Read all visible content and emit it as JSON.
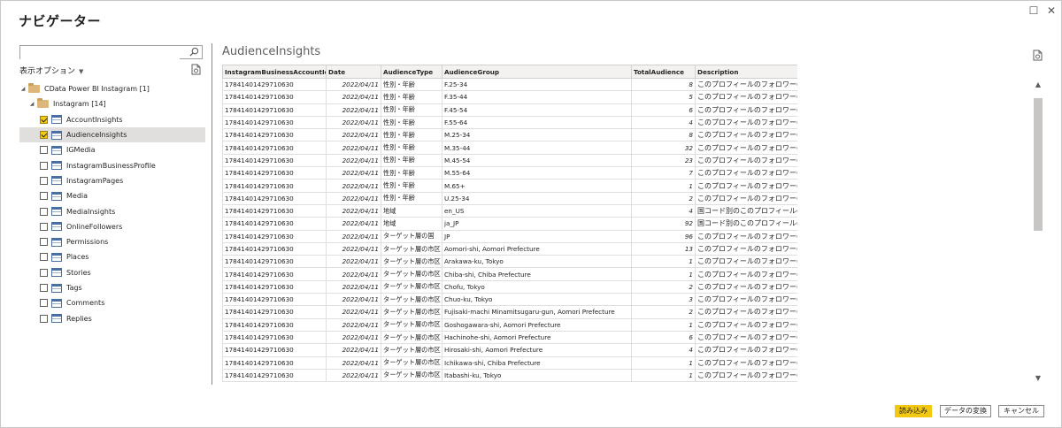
{
  "window": {
    "title": "ナビゲーター",
    "restore_glyph": "☐",
    "close_glyph": "✕"
  },
  "left": {
    "search": {
      "value": "",
      "placeholder": ""
    },
    "display_options": "表示オプション",
    "tree": {
      "root": {
        "label": "CData Power BI Instagram [1]"
      },
      "folder": {
        "label": "Instagram [14]"
      },
      "items": [
        {
          "label": "AccountInsights",
          "checked": true,
          "selected": false
        },
        {
          "label": "AudienceInsights",
          "checked": true,
          "selected": true
        },
        {
          "label": "IGMedia",
          "checked": false,
          "selected": false
        },
        {
          "label": "InstagramBusinessProfile",
          "checked": false,
          "selected": false
        },
        {
          "label": "InstagramPages",
          "checked": false,
          "selected": false
        },
        {
          "label": "Media",
          "checked": false,
          "selected": false
        },
        {
          "label": "MediaInsights",
          "checked": false,
          "selected": false
        },
        {
          "label": "OnlineFollowers",
          "checked": false,
          "selected": false
        },
        {
          "label": "Permissions",
          "checked": false,
          "selected": false
        },
        {
          "label": "Places",
          "checked": false,
          "selected": false
        },
        {
          "label": "Stories",
          "checked": false,
          "selected": false
        },
        {
          "label": "Tags",
          "checked": false,
          "selected": false
        },
        {
          "label": "Comments",
          "checked": false,
          "selected": false
        },
        {
          "label": "Replies",
          "checked": false,
          "selected": false
        }
      ]
    }
  },
  "preview": {
    "title": "AudienceInsights",
    "columns": [
      "InstagramBusinessAccountId",
      "Date",
      "AudienceType",
      "AudienceGroup",
      "TotalAudience",
      "Description"
    ],
    "rows": [
      [
        "17841401429710630",
        "2022/04/11",
        "性別・年齢",
        "F.25-34",
        "8",
        "このプロフィールのフォロワーの"
      ],
      [
        "17841401429710630",
        "2022/04/11",
        "性別・年齢",
        "F.35-44",
        "5",
        "このプロフィールのフォロワーの"
      ],
      [
        "17841401429710630",
        "2022/04/11",
        "性別・年齢",
        "F.45-54",
        "6",
        "このプロフィールのフォロワーの"
      ],
      [
        "17841401429710630",
        "2022/04/11",
        "性別・年齢",
        "F.55-64",
        "4",
        "このプロフィールのフォロワーの"
      ],
      [
        "17841401429710630",
        "2022/04/11",
        "性別・年齢",
        "M.25-34",
        "8",
        "このプロフィールのフォロワーの"
      ],
      [
        "17841401429710630",
        "2022/04/11",
        "性別・年齢",
        "M.35-44",
        "32",
        "このプロフィールのフォロワーの"
      ],
      [
        "17841401429710630",
        "2022/04/11",
        "性別・年齢",
        "M.45-54",
        "23",
        "このプロフィールのフォロワーの"
      ],
      [
        "17841401429710630",
        "2022/04/11",
        "性別・年齢",
        "M.55-64",
        "7",
        "このプロフィールのフォロワーの"
      ],
      [
        "17841401429710630",
        "2022/04/11",
        "性別・年齢",
        "M.65+",
        "1",
        "このプロフィールのフォロワーの"
      ],
      [
        "17841401429710630",
        "2022/04/11",
        "性別・年齢",
        "U.25-34",
        "2",
        "このプロフィールのフォロワーの"
      ],
      [
        "17841401429710630",
        "2022/04/11",
        "地域",
        "en_US",
        "4",
        "国コード別のこのプロフィールの"
      ],
      [
        "17841401429710630",
        "2022/04/11",
        "地域",
        "ja_JP",
        "92",
        "国コード別のこのプロフィールの"
      ],
      [
        "17841401429710630",
        "2022/04/11",
        "ターゲット層の国",
        "JP",
        "96",
        "このプロフィールのフォロワーの"
      ],
      [
        "17841401429710630",
        "2022/04/11",
        "ターゲット層の市区",
        "Aomori-shi, Aomori Prefecture",
        "13",
        "このプロフィールのフォロワーの"
      ],
      [
        "17841401429710630",
        "2022/04/11",
        "ターゲット層の市区",
        "Arakawa-ku, Tokyo",
        "1",
        "このプロフィールのフォロワーの"
      ],
      [
        "17841401429710630",
        "2022/04/11",
        "ターゲット層の市区",
        "Chiba-shi, Chiba Prefecture",
        "1",
        "このプロフィールのフォロワーの"
      ],
      [
        "17841401429710630",
        "2022/04/11",
        "ターゲット層の市区",
        "Chofu, Tokyo",
        "2",
        "このプロフィールのフォロワーの"
      ],
      [
        "17841401429710630",
        "2022/04/11",
        "ターゲット層の市区",
        "Chuo-ku, Tokyo",
        "3",
        "このプロフィールのフォロワーの"
      ],
      [
        "17841401429710630",
        "2022/04/11",
        "ターゲット層の市区",
        "Fujisaki-machi Minamitsugaru-gun, Aomori Prefecture",
        "2",
        "このプロフィールのフォロワーの"
      ],
      [
        "17841401429710630",
        "2022/04/11",
        "ターゲット層の市区",
        "Goshogawara-shi, Aomori Prefecture",
        "1",
        "このプロフィールのフォロワーの"
      ],
      [
        "17841401429710630",
        "2022/04/11",
        "ターゲット層の市区",
        "Hachinohe-shi, Aomori Prefecture",
        "6",
        "このプロフィールのフォロワーの"
      ],
      [
        "17841401429710630",
        "2022/04/11",
        "ターゲット層の市区",
        "Hirosaki-shi, Aomori Prefecture",
        "4",
        "このプロフィールのフォロワーの"
      ],
      [
        "17841401429710630",
        "2022/04/11",
        "ターゲット層の市区",
        "Ichikawa-shi, Chiba Prefecture",
        "1",
        "このプロフィールのフォロワーの"
      ],
      [
        "17841401429710630",
        "2022/04/11",
        "ターゲット層の市区",
        "Itabashi-ku, Tokyo",
        "1",
        "このプロフィールのフォロワーの"
      ]
    ]
  },
  "footer": {
    "load": "読み込み",
    "transform": "データの変換",
    "cancel": "キャンセル"
  },
  "colors": {
    "accent": "#f2c811",
    "selected_row": "#e1dfdd",
    "folder": "#dcb67a"
  }
}
